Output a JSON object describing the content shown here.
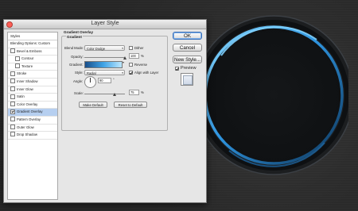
{
  "dialog": {
    "title": "Layer Style"
  },
  "styles_panel": {
    "header": "Styles",
    "items": [
      {
        "label": "Blending Options: Custom",
        "checkbox": false,
        "sub": false,
        "selected": false,
        "checked": false
      },
      {
        "label": "Bevel & Emboss",
        "checkbox": true,
        "sub": false,
        "selected": false,
        "checked": false
      },
      {
        "label": "Contour",
        "checkbox": true,
        "sub": true,
        "selected": false,
        "checked": false
      },
      {
        "label": "Texture",
        "checkbox": true,
        "sub": true,
        "selected": false,
        "checked": false
      },
      {
        "label": "Stroke",
        "checkbox": true,
        "sub": false,
        "selected": false,
        "checked": false
      },
      {
        "label": "Inner Shadow",
        "checkbox": true,
        "sub": false,
        "selected": false,
        "checked": false
      },
      {
        "label": "Inner Glow",
        "checkbox": true,
        "sub": false,
        "selected": false,
        "checked": false
      },
      {
        "label": "Satin",
        "checkbox": true,
        "sub": false,
        "selected": false,
        "checked": false
      },
      {
        "label": "Color Overlay",
        "checkbox": true,
        "sub": false,
        "selected": false,
        "checked": false
      },
      {
        "label": "Gradient Overlay",
        "checkbox": true,
        "sub": false,
        "selected": true,
        "checked": true
      },
      {
        "label": "Pattern Overlay",
        "checkbox": true,
        "sub": false,
        "selected": false,
        "checked": false
      },
      {
        "label": "Outer Glow",
        "checkbox": true,
        "sub": false,
        "selected": false,
        "checked": false
      },
      {
        "label": "Drop Shadow",
        "checkbox": true,
        "sub": false,
        "selected": false,
        "checked": false
      }
    ]
  },
  "gradient_overlay": {
    "section_title": "Gradient Overlay",
    "group_title": "Gradient",
    "blend_mode_label": "Blend Mode:",
    "blend_mode_value": "Color Dodge",
    "dither_label": "Dither",
    "dither_checked": false,
    "opacity_label": "Opacity:",
    "opacity_value": "100",
    "opacity_unit": "%",
    "opacity_level": 1.0,
    "gradient_label": "Gradient:",
    "reverse_label": "Reverse",
    "reverse_checked": false,
    "gradient_colors": [
      "#1a4f8a",
      "#3fa3e6",
      "#bde7ff"
    ],
    "style_label": "Style:",
    "style_value": "Radial",
    "align_label": "Align with Layer",
    "align_checked": true,
    "angle_label": "Angle:",
    "angle_value": "90",
    "angle_unit": "°",
    "scale_label": "Scale:",
    "scale_value": "75",
    "scale_unit": "%",
    "scale_level": 0.75,
    "make_default_label": "Make Default",
    "reset_default_label": "Reset to Default"
  },
  "actions": {
    "ok_label": "OK",
    "cancel_label": "Cancel",
    "new_style_label": "New Style...",
    "preview_label": "Preview",
    "preview_checked": true
  },
  "colors": {
    "selection": "#b6cff0",
    "ring_glow": "#2f95e0",
    "canvas_bg": "#2b2b2b"
  }
}
